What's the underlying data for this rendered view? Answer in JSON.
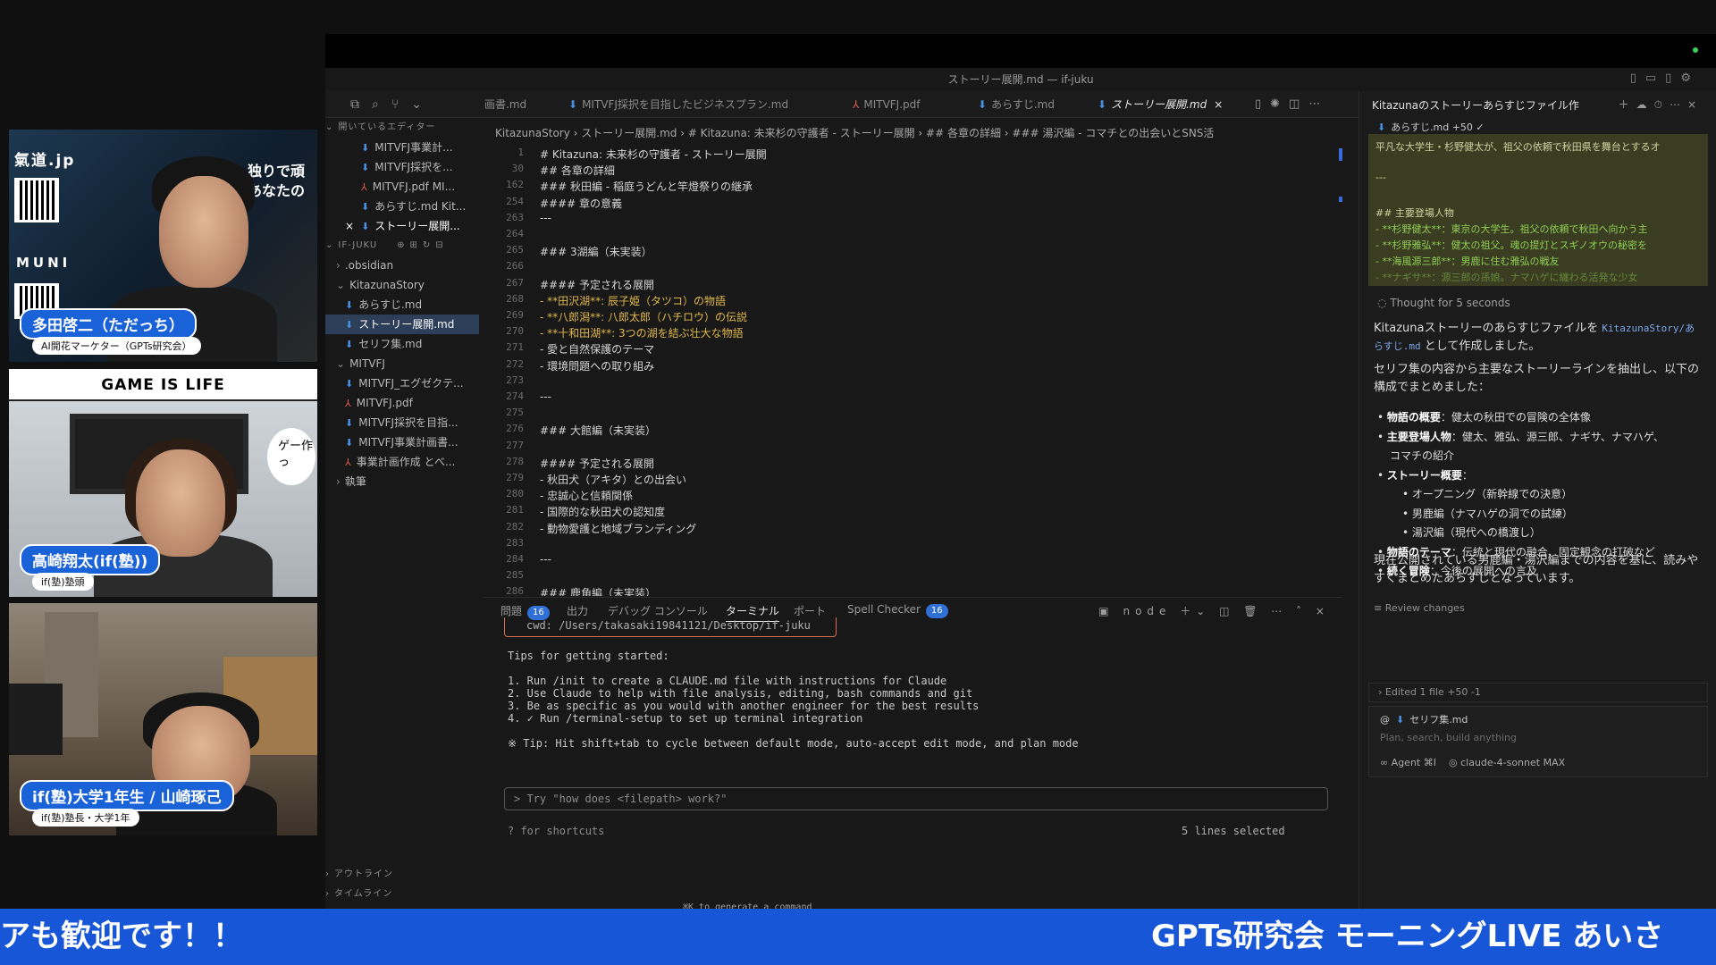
{
  "webcams": {
    "cam1": {
      "brand": "氣道.jp",
      "brand2": "MUNI",
      "side_text": [
        "独りで頑",
        "あなたの"
      ],
      "name": "多田啓二（ただっち）",
      "subtitle": "AI開花マーケター（GPTs研究会）"
    },
    "cam2": {
      "banner": "GAME IS LIFE",
      "bubble": "ゲー作っ",
      "name": "高崎翔太(if(塾))",
      "subtitle": "if(塾)塾頭"
    },
    "cam3": {
      "name": "if(塾)大学1年生 / 山崎琢己",
      "subtitle": "if(塾)塾長・大学1年"
    }
  },
  "editor": {
    "window_title": "ストーリー展開.md — if-juku",
    "tabs": [
      {
        "label": "画書.md",
        "type": "md"
      },
      {
        "label": "MITVFJ採択を目指したビジネスプラン.md",
        "type": "md"
      },
      {
        "label": "MITVFJ.pdf",
        "type": "pdf"
      },
      {
        "label": "あらすじ.md",
        "type": "md"
      },
      {
        "label": "ストーリー展開.md",
        "type": "md",
        "active": true
      }
    ],
    "sidebar": {
      "open_editors_header": "開いているエディター",
      "open_editors": [
        {
          "label": "MITVFJ事業計...",
          "type": "md"
        },
        {
          "label": "MITVFJ採択を...",
          "type": "md"
        },
        {
          "label": "MITVFJ.pdf  MI...",
          "type": "pdf"
        },
        {
          "label": "あらすじ.md  Kit...",
          "type": "md"
        },
        {
          "label": "ストーリー展開...",
          "type": "md"
        }
      ],
      "workspace_header": "IF-JUKU",
      "tree": [
        {
          "label": ".obsidian",
          "kind": "folder-closed"
        },
        {
          "label": "KitazunaStory",
          "kind": "folder-open"
        },
        {
          "label": "あらすじ.md",
          "kind": "md"
        },
        {
          "label": "ストーリー展開.md",
          "kind": "md",
          "selected": true
        },
        {
          "label": "セリフ集.md",
          "kind": "md"
        },
        {
          "label": "MITVFJ",
          "kind": "folder-open"
        },
        {
          "label": "MITVFJ_エグゼクテ...",
          "kind": "md"
        },
        {
          "label": "MITVFJ.pdf",
          "kind": "pdf"
        },
        {
          "label": "MITVFJ採択を目指...",
          "kind": "md"
        },
        {
          "label": "MITVFJ事業計画書...",
          "kind": "md"
        },
        {
          "label": "事業計画作成 とべ...",
          "kind": "pdf"
        },
        {
          "label": "執筆",
          "kind": "folder-closed"
        }
      ],
      "outline": "アウトライン",
      "timeline": "タイムライン"
    },
    "breadcrumb": "KitazunaStory  ›  ストーリー展開.md  ›  # Kitazuna: 未来杉の守護者 - ストーリー展開  ›  ## 各章の詳細  ›  ### 湯沢編 - コマチとの出会いとSNS活",
    "code_lines": [
      {
        "n": "1",
        "t": "# Kitazuna: 未来杉の守護者 - ストーリー展開"
      },
      {
        "n": "30",
        "t": "## 各章の詳細"
      },
      {
        "n": "162",
        "t": "### 秋田編 - 稲庭うどんと竿燈祭りの継承"
      },
      {
        "n": "254",
        "t": "#### 章の意義"
      },
      {
        "n": "263",
        "t": "---"
      },
      {
        "n": "264",
        "t": ""
      },
      {
        "n": "265",
        "t": "### 3湖編（未実装）"
      },
      {
        "n": "266",
        "t": ""
      },
      {
        "n": "267",
        "t": "#### 予定される展開"
      },
      {
        "n": "268",
        "t": "- **田沢湖**: 辰子姫（タツコ）の物語"
      },
      {
        "n": "269",
        "t": "- **八郎潟**: 八郎太郎（ハチロウ）の伝説"
      },
      {
        "n": "270",
        "t": "- **十和田湖**: 3つの湖を結ぶ壮大な物語"
      },
      {
        "n": "271",
        "t": "- 愛と自然保護のテーマ"
      },
      {
        "n": "272",
        "t": "- 環境問題への取り組み"
      },
      {
        "n": "273",
        "t": ""
      },
      {
        "n": "274",
        "t": "---"
      },
      {
        "n": "275",
        "t": ""
      },
      {
        "n": "276",
        "t": "### 大館編（未実装）"
      },
      {
        "n": "277",
        "t": ""
      },
      {
        "n": "278",
        "t": "#### 予定される展開"
      },
      {
        "n": "279",
        "t": "- 秋田犬（アキタ）との出会い"
      },
      {
        "n": "280",
        "t": "- 忠誠心と信頼関係"
      },
      {
        "n": "281",
        "t": "- 国際的な秋田犬の認知度"
      },
      {
        "n": "282",
        "t": "- 動物愛護と地域ブランディング"
      },
      {
        "n": "283",
        "t": ""
      },
      {
        "n": "284",
        "t": "---"
      },
      {
        "n": "285",
        "t": ""
      },
      {
        "n": "286",
        "t": "### 鹿角編（未実装）"
      }
    ],
    "panel": {
      "tabs": [
        {
          "label": "問題",
          "badge": "16"
        },
        {
          "label": "出力"
        },
        {
          "label": "デバッグ コンソール"
        },
        {
          "label": "ターミナル",
          "active": true
        },
        {
          "label": "ポート"
        },
        {
          "label": "Spell Checker",
          "badge": "16"
        }
      ],
      "terminal_name": "node",
      "cwd": "cwd: /Users/takasaki19841121/Desktop/if-juku",
      "tips_header": "Tips for getting started:",
      "tips": [
        "1. Run /init to create a CLAUDE.md file with instructions for Claude",
        "2. Use Claude to help with file analysis, editing, bash commands and git",
        "3. Be as specific as you would with another engineer for the best results",
        "4. ✓ Run /terminal-setup to set up terminal integration"
      ],
      "tip_line": "※ Tip: Hit shift+tab to cycle between default mode, auto-accept edit mode, and plan mode",
      "prompt_placeholder": "> Try \"how does <filepath> work?\"",
      "shortcuts": "? for shortcuts",
      "selection": "5 lines selected",
      "generate_hint": "⌘K to generate a command"
    }
  },
  "chat": {
    "title": "Kitazunaのストーリーあらすじファイル作",
    "diff_file": "あらすじ.md +50 ✓",
    "diff_lines": [
      {
        "t": "平凡な大学生・杉野健太が、祖父の依頼で秋田県を舞台とするオ",
        "green": false
      },
      {
        "t": "---",
        "green": false
      },
      {
        "t": "## 主要登場人物",
        "green": false
      },
      {
        "t": "- **杉野健太**：東京の大学生。祖父の依頼で秋田へ向かう主",
        "green": true
      },
      {
        "t": "- **杉野雅弘**：健太の祖父。魂の提灯とスギノオウの秘密を",
        "green": true
      },
      {
        "t": "- **海風源三郎**：男鹿に住む雅弘の戦友",
        "green": true
      },
      {
        "t": "- **ナギサ**：源三郎の孫娘。ナマハゲに纏わる活発な少女",
        "green": true
      }
    ],
    "thought": "Thought for 5 seconds",
    "para1_pre": "Kitazunaストーリーのあらすじファイルを",
    "para1_code": "KitazunaStory/あらすじ.md",
    "para1_post": "として作成しました。",
    "para2": "セリフ集の内容から主要なストーリーラインを抽出し、以下の構成でまとめました：",
    "bullets": [
      {
        "b": "物語の概要",
        "t": "：健太の秋田での冒険の全体像",
        "level": 1
      },
      {
        "b": "主要登場人物",
        "t": "：健太、雅弘、源三郎、ナギサ、ナマハゲ、",
        "level": 1
      },
      {
        "b": "",
        "t": "コマチの紹介",
        "level": 0
      },
      {
        "b": "ストーリー概要",
        "t": "：",
        "level": 1
      },
      {
        "b": "",
        "t": "オープニング（新幹線での決意）",
        "level": 2
      },
      {
        "b": "",
        "t": "男鹿編（ナマハゲの洞での試練）",
        "level": 2
      },
      {
        "b": "",
        "t": "湯沢編（現代への橋渡し）",
        "level": 2
      },
      {
        "b": "物語のテーマ",
        "t": "：伝統と現代の融合、固定観念の打破など",
        "level": 1
      },
      {
        "b": "続く冒険",
        "t": "：今後の展開への言及",
        "level": 1
      }
    ],
    "para3": "現在公開されている男鹿編・湯沢編までの内容を基に、読みやすくまとめたあらすじとなっています。",
    "review": "Review changes",
    "edited": "Edited 1 file +50 -1",
    "input_file": "セリフ集.md",
    "input_placeholder": "Plan, search, build anything",
    "agent_label": "Agent ⌘I",
    "model_label": "claude-4-sonnet MAX"
  },
  "ticker": {
    "left": "アも歓迎です！！",
    "right": "GPTs研究会 モーニングLIVE あいさ"
  }
}
